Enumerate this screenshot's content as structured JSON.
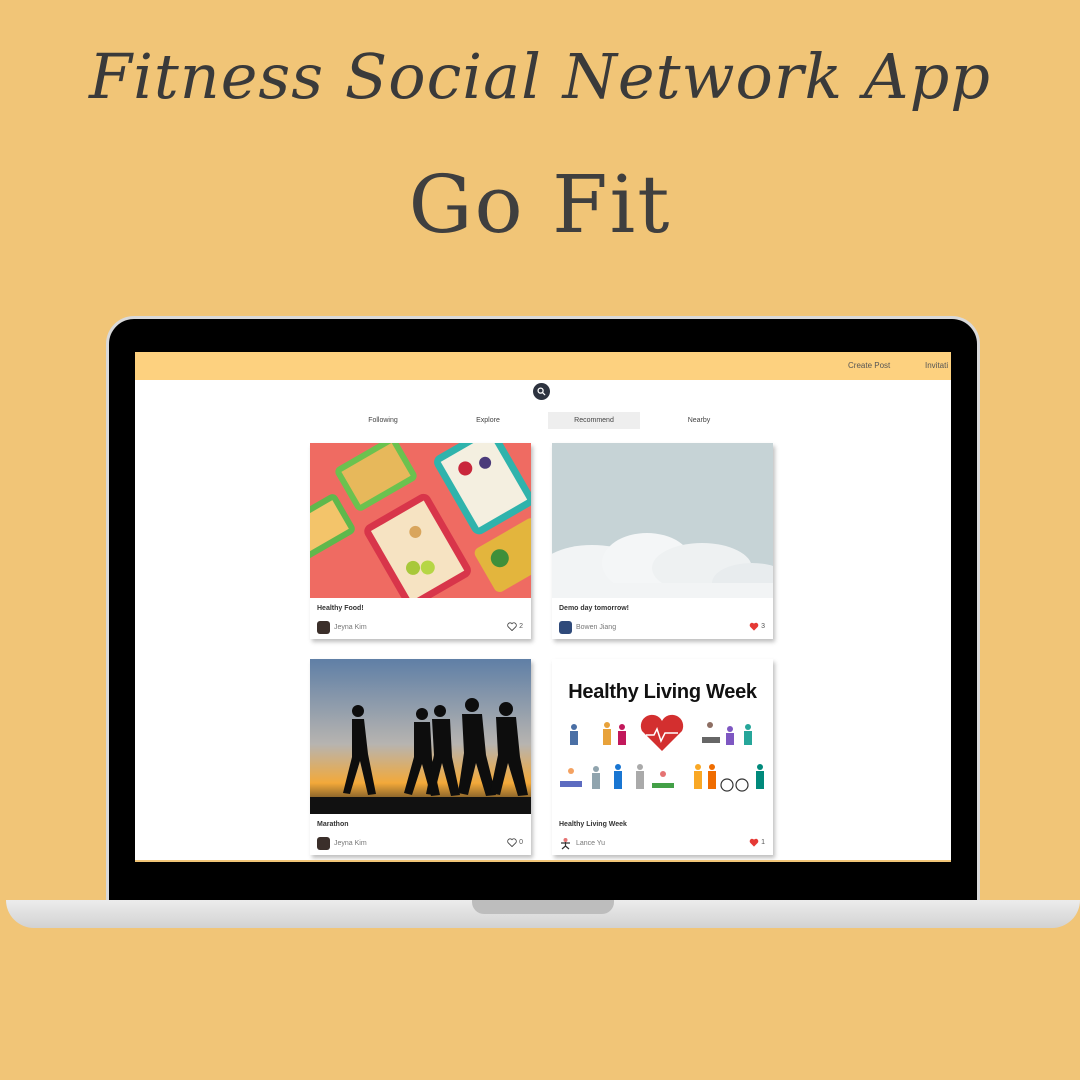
{
  "promo": {
    "headline": "Fitness Social Network App",
    "app_name": "Go Fit"
  },
  "header": {
    "nav": [
      "Create Post",
      "Invitati"
    ]
  },
  "search": {
    "icon": "search-icon"
  },
  "tabs": [
    {
      "label": "Following",
      "active": false
    },
    {
      "label": "Explore",
      "active": false
    },
    {
      "label": "Recommend",
      "active": true
    },
    {
      "label": "Nearby",
      "active": false
    }
  ],
  "posts": [
    {
      "title": "Healthy Food!",
      "author": "Jeyna Kim",
      "likes": "2",
      "liked": false,
      "image": "healthy-food-photo"
    },
    {
      "title": "Demo day tomorrow!",
      "author": "Bowen Jiang",
      "likes": "3",
      "liked": true,
      "image": "sky-clouds-photo"
    },
    {
      "title": "Marathon",
      "author": "Jeyna Kim",
      "likes": "0",
      "liked": false,
      "image": "runners-silhouette-photo"
    },
    {
      "title": "Healthy Living Week",
      "author": "Lance Yu",
      "likes": "1",
      "liked": true,
      "image": "healthy-living-week-illustration",
      "image_text": "Healthy Living Week"
    }
  ],
  "colors": {
    "background": "#f1c577",
    "topbar": "#fdd17f",
    "like_red": "#e53935"
  }
}
